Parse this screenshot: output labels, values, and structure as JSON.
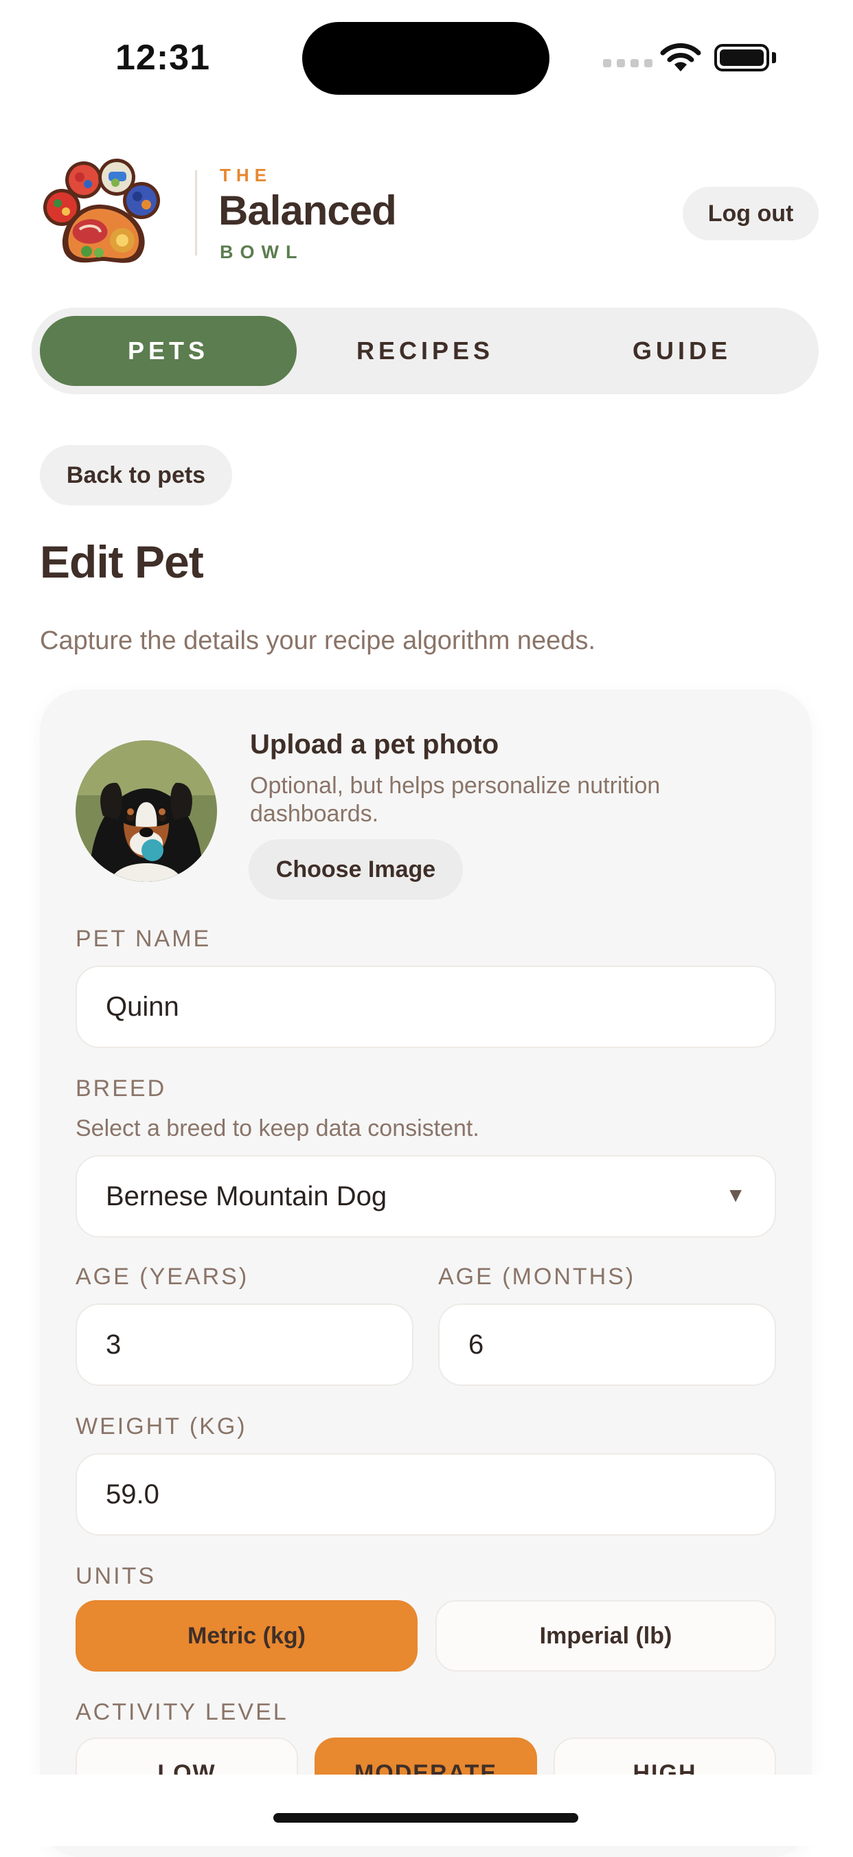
{
  "status_bar": {
    "time": "12:31"
  },
  "header": {
    "brand_the": "THE",
    "brand_name": "Balanced",
    "brand_bowl": "BOWL",
    "logout_label": "Log out"
  },
  "tabs": [
    {
      "label": "PETS",
      "active": true
    },
    {
      "label": "RECIPES",
      "active": false
    },
    {
      "label": "GUIDE",
      "active": false
    }
  ],
  "back_label": "Back to pets",
  "page": {
    "title": "Edit Pet",
    "subtitle": "Capture the details your recipe algorithm needs."
  },
  "photo": {
    "title": "Upload a pet photo",
    "description": "Optional, but helps personalize nutrition dashboards.",
    "button": "Choose Image"
  },
  "form": {
    "pet_name": {
      "label": "PET NAME",
      "value": "Quinn"
    },
    "breed": {
      "label": "BREED",
      "hint": "Select a breed to keep data consistent.",
      "value": "Bernese Mountain Dog"
    },
    "age_years": {
      "label": "AGE (YEARS)",
      "value": "3"
    },
    "age_months": {
      "label": "AGE (MONTHS)",
      "value": "6"
    },
    "weight": {
      "label": "WEIGHT (KG)",
      "value": "59.0"
    },
    "units": {
      "label": "UNITS",
      "options": [
        "Metric (kg)",
        "Imperial (lb)"
      ],
      "selected": "Metric (kg)"
    },
    "activity": {
      "label": "ACTIVITY LEVEL",
      "options": [
        "LOW",
        "MODERATE",
        "HIGH"
      ],
      "selected": "MODERATE"
    }
  },
  "colors": {
    "brand_green": "#5b7d4f",
    "accent_orange": "#e8882f",
    "text_brown": "#3f2f28",
    "muted_text": "#8a7468"
  }
}
